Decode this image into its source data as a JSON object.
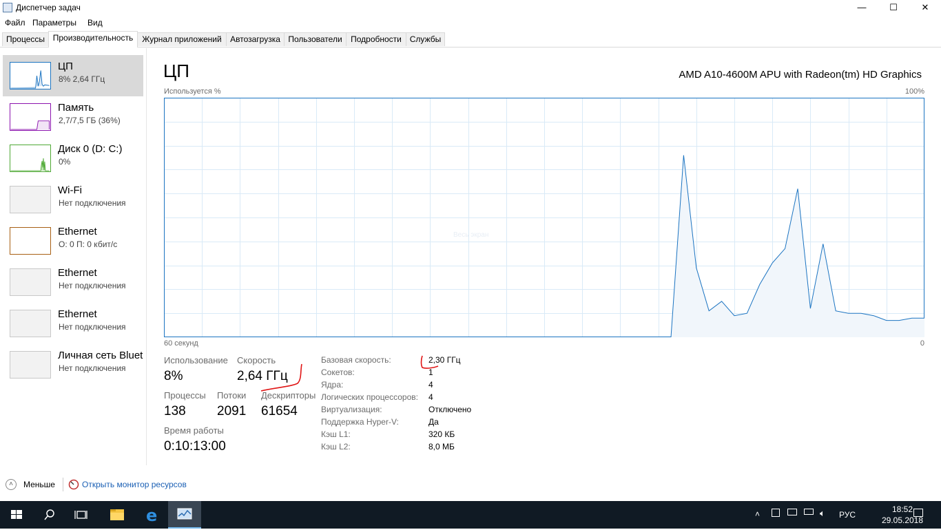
{
  "window": {
    "title": "Диспетчер задач",
    "controls": {
      "minimize": "—",
      "maximize": "☐",
      "close": "✕"
    }
  },
  "menu": [
    "Файл",
    "Параметры",
    "Вид"
  ],
  "tabs": [
    "Процессы",
    "Производительность",
    "Журнал приложений",
    "Автозагрузка",
    "Пользователи",
    "Подробности",
    "Службы"
  ],
  "active_tab": "Производительность",
  "sidebar": {
    "items": [
      {
        "title": "ЦП",
        "subtitle": "8%  2,64 ГГц",
        "color": "#1a73c1"
      },
      {
        "title": "Память",
        "subtitle": "2,7/7,5 ГБ (36%)",
        "color": "#8b12ae"
      },
      {
        "title": "Диск 0 (D: C:)",
        "subtitle": "0%",
        "color": "#4da833"
      },
      {
        "title": "Wi-Fi",
        "subtitle": "Нет подключения",
        "color": "#a0a0a0"
      },
      {
        "title": "Ethernet",
        "subtitle": "О: 0 П: 0 кбит/с",
        "color": "#a75f12"
      },
      {
        "title": "Ethernet",
        "subtitle": "Нет подключения",
        "color": "#a0a0a0"
      },
      {
        "title": "Ethernet",
        "subtitle": "Нет подключения",
        "color": "#a0a0a0"
      },
      {
        "title": "Личная сеть Bluet",
        "subtitle": "Нет подключения",
        "color": "#a0a0a0"
      }
    ]
  },
  "main": {
    "heading": "ЦП",
    "device": "AMD A10-4600M APU with Radeon(tm) HD Graphics",
    "graph": {
      "ylabel": "Используется %",
      "ymax_label": "100%",
      "xlabel_left": "60 секунд",
      "xlabel_right": "0",
      "watermark": "Весь экран"
    },
    "stats": {
      "usage_label": "Использование",
      "usage": "8%",
      "speed_label": "Скорость",
      "speed": "2,64 ГГц",
      "processes_label": "Процессы",
      "processes": "138",
      "threads_label": "Потоки",
      "threads": "2091",
      "handles_label": "Дескрипторы",
      "handles": "61654",
      "uptime_label": "Время работы",
      "uptime": "0:10:13:00"
    },
    "details": [
      {
        "label": "Базовая скорость:",
        "value": "2,30 ГГц"
      },
      {
        "label": "Сокетов:",
        "value": "1"
      },
      {
        "label": "Ядра:",
        "value": "4"
      },
      {
        "label": "Логических процессоров:",
        "value": "4"
      },
      {
        "label": "Виртуализация:",
        "value": "Отключено"
      },
      {
        "label": "Поддержка Hyper-V:",
        "value": "Да"
      },
      {
        "label": "Кэш L1:",
        "value": "320 КБ"
      },
      {
        "label": "Кэш L2:",
        "value": "8,0 МБ"
      }
    ]
  },
  "footer": {
    "less_label": "Меньше",
    "monitor_link": "Открыть монитор ресурсов"
  },
  "taskbar": {
    "lang": "РУС",
    "time": "18:52",
    "date": "29.05.2018"
  },
  "chart_data": {
    "type": "area",
    "ylim": [
      0,
      100
    ],
    "xlim": [
      60,
      0
    ],
    "x": [
      60,
      20,
      19,
      18,
      17,
      16,
      15,
      14,
      13,
      12,
      11,
      10,
      9,
      8,
      7,
      6,
      5,
      4,
      3,
      2,
      1,
      0
    ],
    "y": [
      0,
      0,
      76,
      29,
      11,
      15,
      9,
      10,
      22,
      31,
      37,
      62,
      12,
      39,
      11,
      10,
      10,
      9,
      7,
      7,
      8,
      8
    ],
    "series": [
      {
        "name": "",
        "color": "#1a73c1"
      }
    ]
  }
}
